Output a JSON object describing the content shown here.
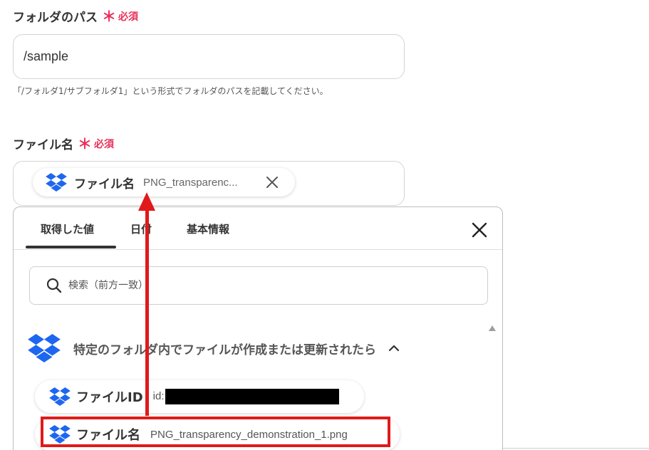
{
  "folder_field": {
    "label": "フォルダのパス",
    "required_star": "＊",
    "required_text": "必須",
    "value": "/sample",
    "hint": "「/フォルダ1/サブフォルダ1」という形式でフォルダのパスを記載してください。"
  },
  "filename_field": {
    "label": "ファイル名",
    "required_star": "＊",
    "required_text": "必須",
    "chip": {
      "icon": "dropbox-icon",
      "title": "ファイル名",
      "value": "PNG_transparenc..."
    }
  },
  "picker": {
    "tabs": [
      {
        "label": "取得した値",
        "active": true
      },
      {
        "label": "日付",
        "active": false
      },
      {
        "label": "基本情報",
        "active": false
      }
    ],
    "search_placeholder": "検索（前方一致）",
    "section": {
      "icon": "dropbox-icon",
      "title": "特定のフォルダ内でファイルが作成または更新されたら"
    },
    "outputs": [
      {
        "title": "ファイルID",
        "value": "id:"
      },
      {
        "title": "ファイル名",
        "value": "PNG_transparency_demonstration_1.png"
      }
    ]
  },
  "colors": {
    "required": "#e8305a",
    "dropbox_blue": "#1d66f0",
    "annotation_red": "#e01a1a"
  }
}
